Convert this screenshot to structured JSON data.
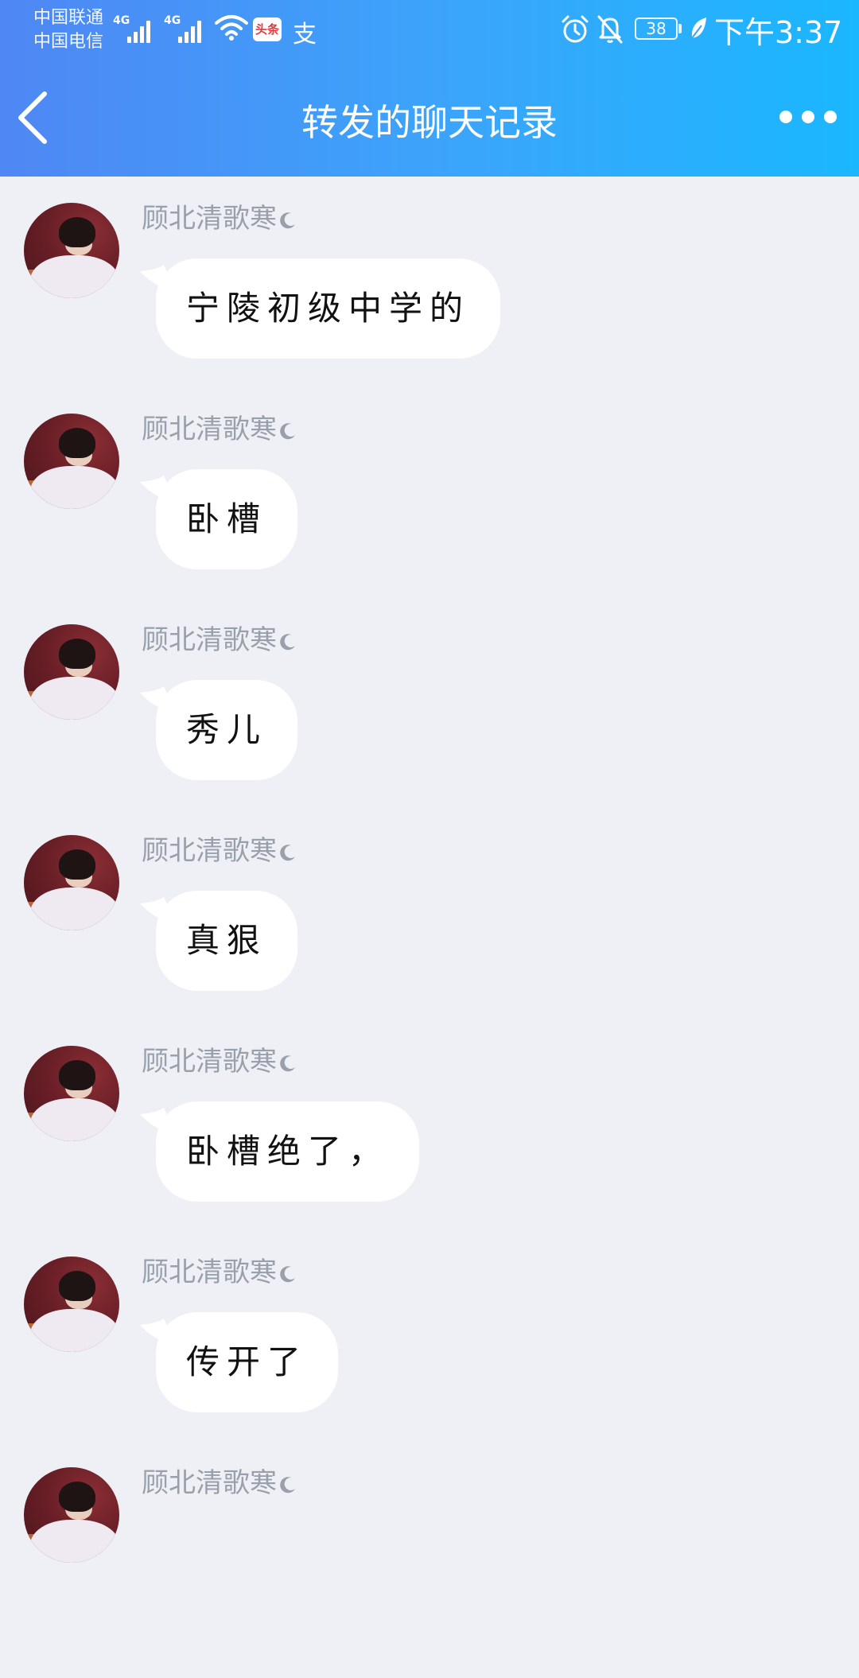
{
  "status_bar": {
    "carrier_1": "中国联通",
    "carrier_2": "中国电信",
    "network_1": "4G",
    "network_2": "4G",
    "app_badge": "头条",
    "app_icon_2": "支",
    "battery": "38",
    "time": "下午3:37"
  },
  "header": {
    "title": "转发的聊天记录",
    "back_icon": "chevron-left-icon",
    "more_icon": "more-dots-icon"
  },
  "messages": [
    {
      "sender": "顾北清歌寒",
      "text": "宁陵初级中学的"
    },
    {
      "sender": "顾北清歌寒",
      "text": "卧槽"
    },
    {
      "sender": "顾北清歌寒",
      "text": "秀儿"
    },
    {
      "sender": "顾北清歌寒",
      "text": "真狠"
    },
    {
      "sender": "顾北清歌寒",
      "text": "卧槽绝了，"
    },
    {
      "sender": "顾北清歌寒",
      "text": "传开了"
    },
    {
      "sender": "顾北清歌寒",
      "text": ""
    }
  ],
  "colors": {
    "header_start": "#4f87f4",
    "header_end": "#1ab7ff",
    "background": "#eff0f6",
    "bubble": "#ffffff",
    "sender_text": "#9aa0ab"
  }
}
